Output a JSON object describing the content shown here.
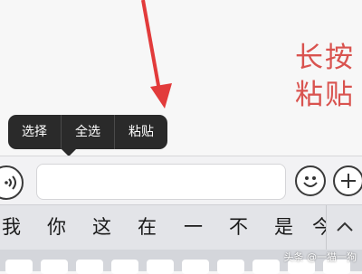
{
  "annotation": {
    "line1": "长按",
    "line2": "粘贴",
    "color": "#d9534f"
  },
  "context_menu": {
    "items": [
      "选择",
      "全选",
      "粘贴"
    ]
  },
  "input_bar": {
    "voice_icon": "voice-icon",
    "emoji_icon": "emoji-icon",
    "plus_icon": "plus-icon",
    "text_value": ""
  },
  "candidates": [
    "我",
    "你",
    "这",
    "在",
    "一",
    "不",
    "是",
    "今"
  ],
  "watermark": "头条 @一猫一狗"
}
